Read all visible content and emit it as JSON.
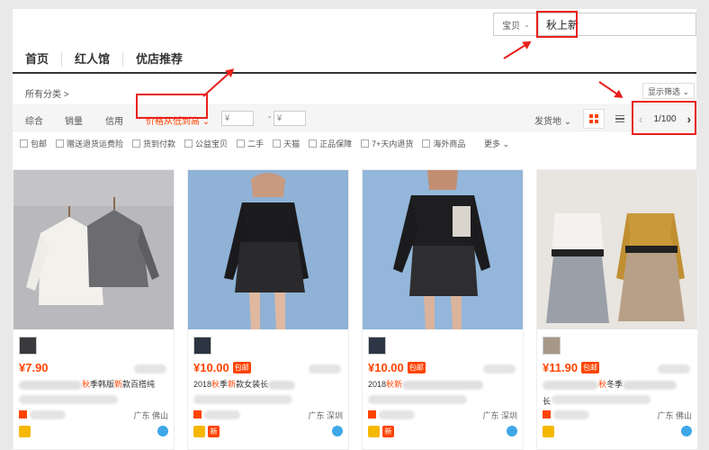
{
  "search": {
    "category": "宝贝",
    "query": "秋上新"
  },
  "nav": {
    "tabs": [
      "首页",
      "红人馆",
      "优店推荐"
    ]
  },
  "breadcrumb": "所有分类 >",
  "filter_toggle": "显示筛选 ⌄",
  "sort": {
    "items": [
      "综合",
      "销量",
      "信用"
    ],
    "price_sort": "价格从低到高",
    "price_min_placeholder": "¥",
    "price_max_placeholder": "¥",
    "price_dash": "-",
    "ship_from": "发货地 ⌄",
    "page": "1/100",
    "prev": "‹",
    "next": "›"
  },
  "filters": [
    "包邮",
    "赠送退货运费险",
    "货到付款",
    "公益宝贝",
    "二手",
    "天猫",
    "正品保障",
    "7+天内退货",
    "海外商品"
  ],
  "more": "更多 ⌄",
  "colors": {
    "accent": "#ff4400",
    "annotation": "#e8201c"
  },
  "products": [
    {
      "price": "¥7.90",
      "ship_badge": "",
      "title_pre": "",
      "title_hl": "秋",
      "title_mid": "季韩版",
      "title_hl2": "新",
      "title_post": "款百搭纯",
      "location": "广东 佛山",
      "new_badge": ""
    },
    {
      "price": "¥10.00",
      "ship_badge": "包邮",
      "title_pre": "2018",
      "title_hl": "秋",
      "title_mid": "季",
      "title_hl2": "新",
      "title_post": "款女装长",
      "location": "广东 深圳",
      "new_badge": "新"
    },
    {
      "price": "¥10.00",
      "ship_badge": "包邮",
      "title_pre": "2018",
      "title_hl": "秋",
      "title_mid": "",
      "title_hl2": "新",
      "title_post": "",
      "location": "广东 深圳",
      "new_badge": "新"
    },
    {
      "price": "¥11.90",
      "ship_badge": "包邮",
      "title_pre": "",
      "title_hl": "秋",
      "title_mid": "冬季",
      "title_hl2": "",
      "title_post": "长",
      "location": "广东 佛山",
      "new_badge": ""
    }
  ]
}
